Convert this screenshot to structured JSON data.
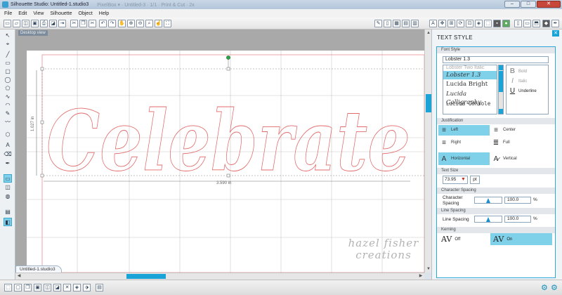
{
  "window": {
    "title": "Silhouette Studio: Untitled-1.studio3",
    "ghost_text": "PixelBox ▾ · Untitled-3 · 1/1 · Print & Cut · 2x"
  },
  "menu": [
    "File",
    "Edit",
    "View",
    "Silhouette",
    "Object",
    "Help"
  ],
  "toolbar": {
    "left_icons": [
      "new-icon",
      "open-icon",
      "open-library-icon",
      "save-icon",
      "print-icon",
      "print-cut-icon",
      "send-icon",
      "cut-icon",
      "copy-icon",
      "paste-icon",
      "undo-icon",
      "redo-icon",
      "pan-icon",
      "zoom-in-icon",
      "zoom-out-icon",
      "zoom-box-icon",
      "drag-icon",
      "fit-page-icon",
      "fill-icon"
    ],
    "right_icons": [
      "draw-icon",
      "page-setup-icon",
      "grid-icon",
      "registration-icon",
      "cut-settings-icon",
      "send-to-silhouette-icon",
      "store-icon",
      "library-icon",
      "design-icon",
      "print-icon",
      "eraser-icon",
      "knife-icon"
    ]
  },
  "canvas": {
    "view_tag": "Desktop view",
    "text": "Celebrate",
    "width_dim": "3.590 in",
    "height_dim": "1.027 in",
    "tab": "Untitled-1.studio3"
  },
  "watermark": {
    "line1": "hazel fisher",
    "line2": "creations"
  },
  "panel": {
    "title": "TEXT STYLE",
    "font_style_header": "Font Style",
    "font_name": "Lobster 1.3",
    "fonts": [
      {
        "name": "Lobster Two Italic",
        "style": "faded"
      },
      {
        "name": "Lobster 1.3",
        "style": "sel"
      },
      {
        "name": "Lucida Bright",
        "style": "normal"
      },
      {
        "name": "Lucida Calligraphy",
        "style": "normal"
      },
      {
        "name": "Lucida Console",
        "style": "normal"
      }
    ],
    "bold": "Bold",
    "italic": "Italic",
    "underline": "Underline",
    "justification_header": "Justification",
    "left": "Left",
    "center": "Center",
    "right": "Right",
    "full": "Full",
    "horizontal": "Horizontal",
    "vertical": "Vertical",
    "text_size_header": "Text Size",
    "text_size": "73.95",
    "text_size_unit": "pt",
    "char_spacing_header": "Character Spacing",
    "char_spacing_label": "Character Spacing",
    "char_spacing_value": "100.0",
    "line_spacing_header": "Line Spacing",
    "line_spacing_label": "Line Spacing",
    "line_spacing_value": "100.0",
    "percent": "%",
    "kerning_header": "Kerning",
    "kern_off": "Off",
    "kern_on": "On"
  }
}
